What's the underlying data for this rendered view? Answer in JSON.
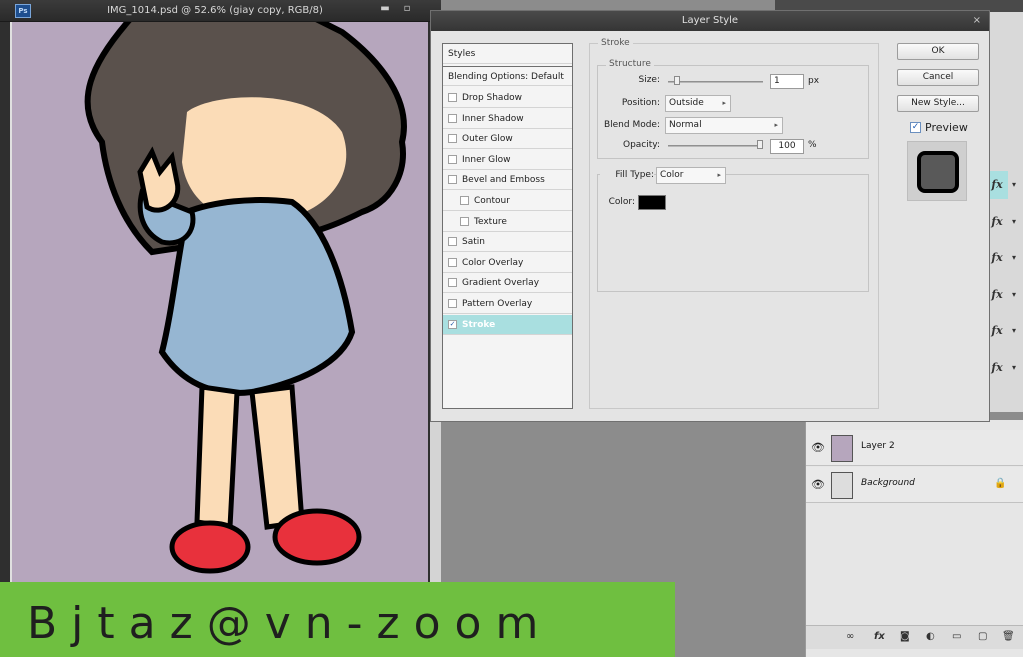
{
  "document": {
    "title": "IMG_1014.psd @ 52.6% (giay copy, RGB/8)",
    "app_badge": "Ps",
    "minimize_glyph": "▬",
    "maximize_glyph": "▫",
    "canvas_bg": "#b6a6bd"
  },
  "dialog": {
    "title": "Layer Style",
    "close_glyph": "×",
    "styles_header": "Styles",
    "blending_options": "Blending Options: Default",
    "effects": [
      {
        "label": "Drop Shadow",
        "checked": false
      },
      {
        "label": "Inner Shadow",
        "checked": false
      },
      {
        "label": "Outer Glow",
        "checked": false
      },
      {
        "label": "Inner Glow",
        "checked": false
      },
      {
        "label": "Bevel and Emboss",
        "checked": false
      },
      {
        "label": "Contour",
        "checked": false,
        "indent": true
      },
      {
        "label": "Texture",
        "checked": false,
        "indent": true
      },
      {
        "label": "Satin",
        "checked": false
      },
      {
        "label": "Color Overlay",
        "checked": false
      },
      {
        "label": "Gradient Overlay",
        "checked": false
      },
      {
        "label": "Pattern Overlay",
        "checked": false
      },
      {
        "label": "Stroke",
        "checked": true,
        "active": true
      }
    ],
    "stroke": {
      "section_title": "Stroke",
      "structure_title": "Structure",
      "size_label": "Size:",
      "size_value": "1",
      "size_unit": "px",
      "position_label": "Position:",
      "position_value": "Outside",
      "blend_mode_label": "Blend Mode:",
      "blend_mode_value": "Normal",
      "opacity_label": "Opacity:",
      "opacity_value": "100",
      "opacity_unit": "%",
      "fill_type_label": "Fill Type:",
      "fill_type_value": "Color",
      "color_label": "Color:",
      "color_value": "#000000"
    },
    "buttons": {
      "ok": "OK",
      "cancel": "Cancel",
      "new_style": "New Style..."
    },
    "preview_label": "Preview",
    "preview_checked": true
  },
  "layers": {
    "rows": [
      {
        "name": "Layer 2",
        "visible": true,
        "locked": false
      },
      {
        "name": "Background",
        "visible": true,
        "locked": true
      }
    ],
    "fx_rows_count": 6,
    "fx_glyph": "fx",
    "highlight": "#a9dfe0"
  },
  "watermark": {
    "text": "Bjtaz@vn-zoom",
    "bg": "#6fbf40"
  }
}
